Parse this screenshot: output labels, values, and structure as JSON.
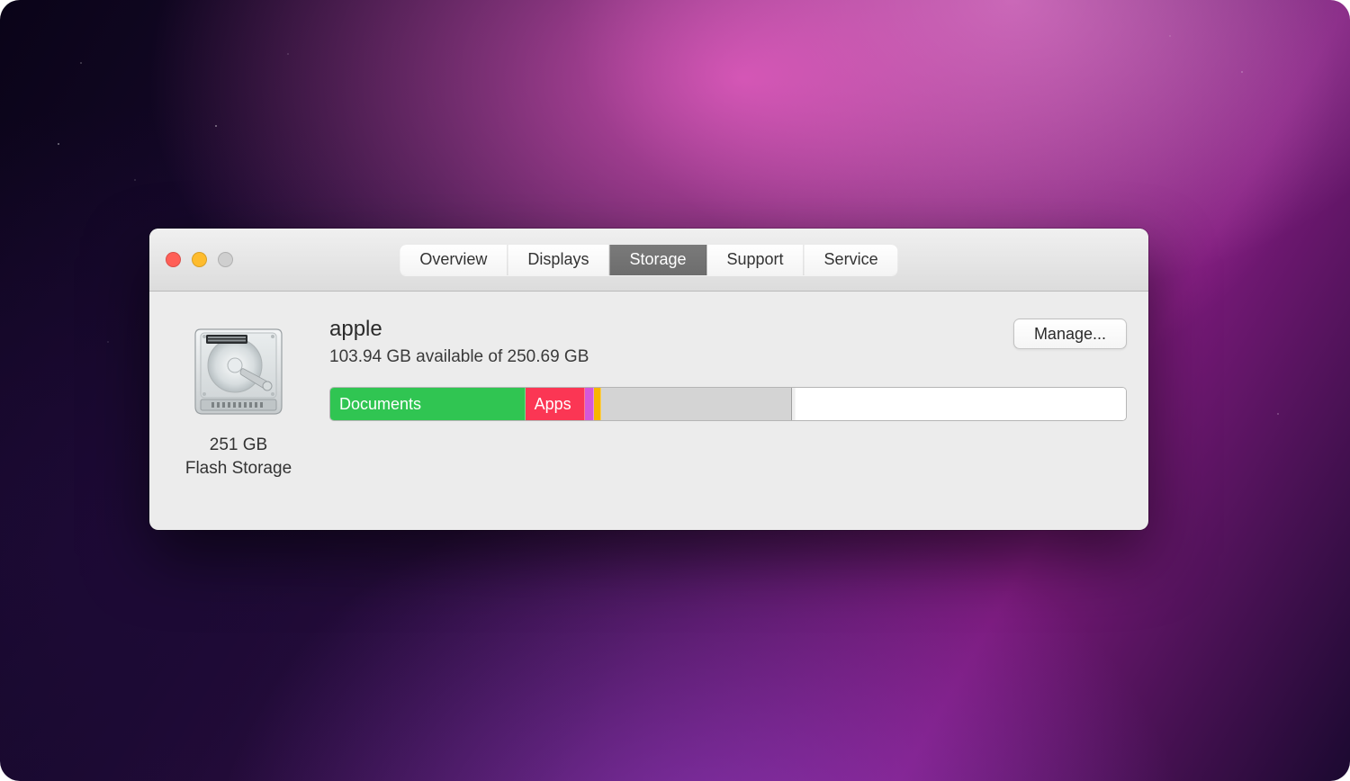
{
  "tabs": {
    "overview": "Overview",
    "displays": "Displays",
    "storage": "Storage",
    "support": "Support",
    "service": "Service",
    "active": "storage"
  },
  "disk": {
    "capacity_line1": "251 GB",
    "capacity_line2": "Flash Storage"
  },
  "volume": {
    "name": "apple",
    "available_line": "103.94 GB available of 250.69 GB"
  },
  "buttons": {
    "manage": "Manage..."
  },
  "storage_bar": {
    "segments": [
      {
        "key": "documents",
        "label": "Documents",
        "color": "#30c552",
        "pct": 24.5
      },
      {
        "key": "apps",
        "label": "Apps",
        "color": "#fb3654",
        "pct": 7.5
      },
      {
        "key": "other1",
        "label": "",
        "color": "#d458d9",
        "pct": 1.2
      },
      {
        "key": "other2",
        "label": "",
        "color": "#f7b500",
        "pct": 0.8
      },
      {
        "key": "system",
        "label": "",
        "color": "#d4d4d4",
        "pct": 24.0
      },
      {
        "key": "sliver",
        "label": "",
        "color": "#eeeeee",
        "pct": 0.5
      },
      {
        "key": "free",
        "label": "",
        "color": "#ffffff",
        "pct": 41.5
      }
    ]
  }
}
